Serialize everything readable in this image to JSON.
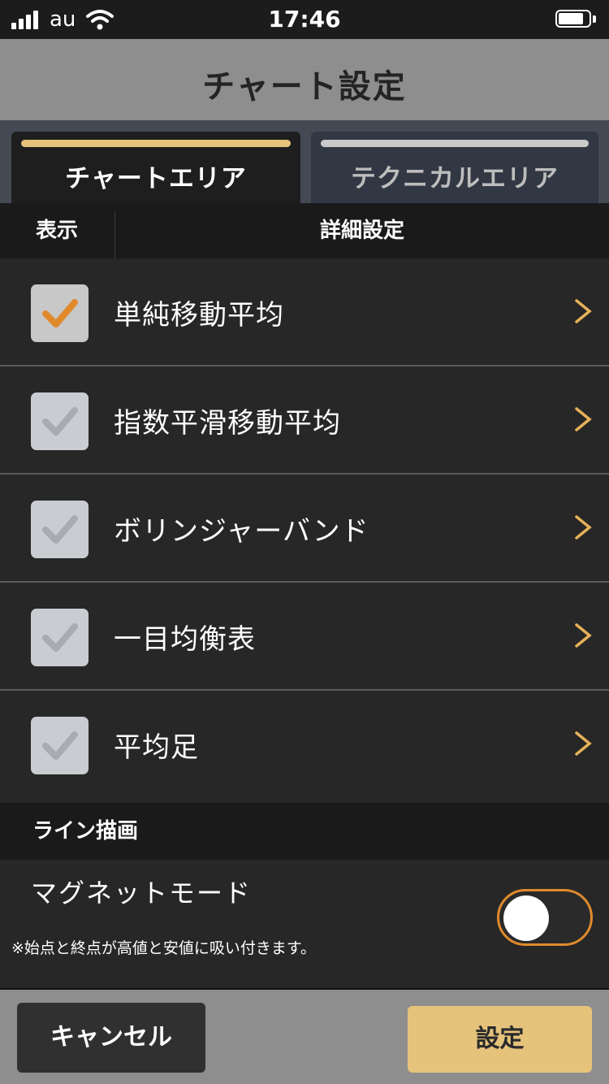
{
  "status_bar": {
    "carrier": "au",
    "time": "17:46"
  },
  "nav": {
    "title": "チャート設定"
  },
  "tabs": [
    {
      "label": "チャートエリア",
      "active": true
    },
    {
      "label": "テクニカルエリア",
      "active": false
    }
  ],
  "columns": {
    "show": "表示",
    "detail": "詳細設定"
  },
  "items": [
    {
      "label": "単純移動平均",
      "checked": true
    },
    {
      "label": "指数平滑移動平均",
      "checked": false
    },
    {
      "label": "ボリンジャーバンド",
      "checked": false
    },
    {
      "label": "一目均衡表",
      "checked": false
    },
    {
      "label": "平均足",
      "checked": false
    }
  ],
  "line_drawing": {
    "section_title": "ライン描画",
    "magnet_title": "マグネットモード",
    "magnet_note": "※始点と終点が高値と安値に吸い付きます。",
    "magnet_enabled": false
  },
  "footer": {
    "cancel_label": "キャンセル",
    "set_label": "設定"
  },
  "colors": {
    "accent": "#e6c37b",
    "check_orange": "#e08a2c",
    "chevron": "#e6b25a",
    "toggle_border": "#e08a2c"
  }
}
